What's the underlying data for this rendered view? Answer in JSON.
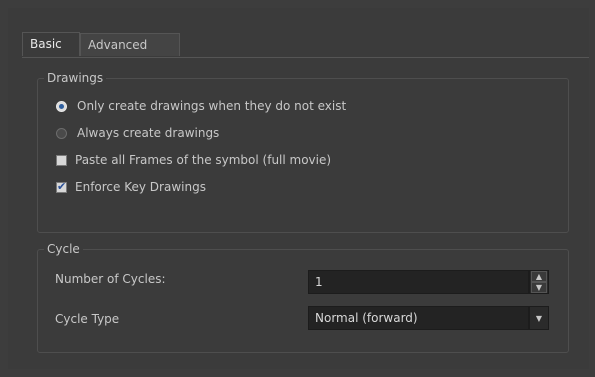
{
  "tabs": [
    {
      "label": "Basic",
      "active": true
    },
    {
      "label": "Advanced",
      "active": false
    }
  ],
  "drawings": {
    "title": "Drawings",
    "options": [
      {
        "label": "Only create drawings when they do not exist",
        "checked": true
      },
      {
        "label": "Always create drawings",
        "checked": false
      }
    ],
    "checkboxes": [
      {
        "label": "Paste all Frames of the symbol (full movie)",
        "checked": false
      },
      {
        "label": "Enforce Key Drawings",
        "checked": true
      }
    ]
  },
  "cycle": {
    "title": "Cycle",
    "number_label": "Number of Cycles:",
    "number_value": "1",
    "type_label": "Cycle Type",
    "type_value": "Normal (forward)"
  },
  "colors": {
    "background": "#3b3b3b",
    "field": "#232323",
    "text": "#c8c8c8"
  },
  "icons": {
    "spin_up": "arrow-up-icon",
    "spin_down": "arrow-down-icon",
    "dropdown": "chevron-down-icon"
  }
}
